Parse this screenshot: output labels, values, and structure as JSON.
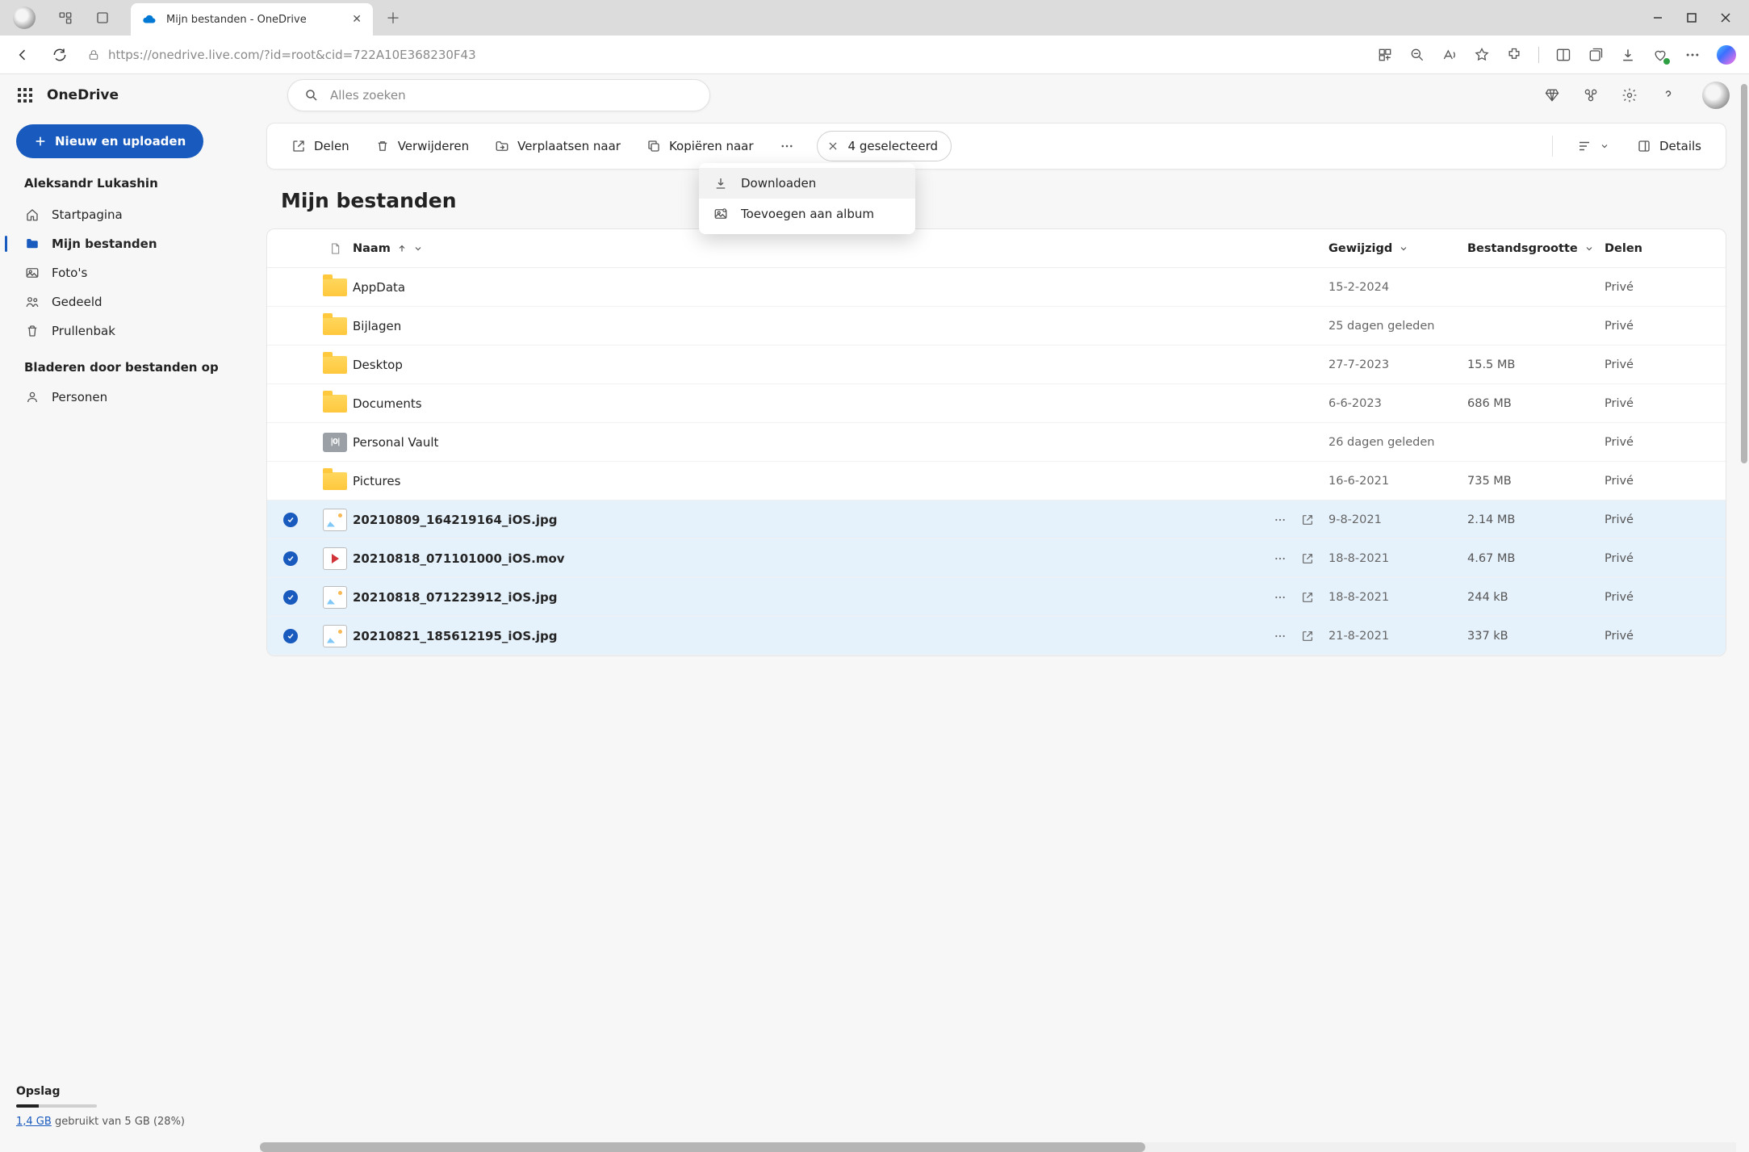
{
  "browser": {
    "tab_title": "Mijn bestanden - OneDrive",
    "url": "https://onedrive.live.com/?id=root&cid=722A10E368230F43"
  },
  "app": {
    "name": "OneDrive",
    "upload_button": "Nieuw en uploaden",
    "search_placeholder": "Alles zoeken"
  },
  "sidebar": {
    "user": "Aleksandr Lukashin",
    "items": [
      {
        "label": "Startpagina"
      },
      {
        "label": "Mijn bestanden"
      },
      {
        "label": "Foto's"
      },
      {
        "label": "Gedeeld"
      },
      {
        "label": "Prullenbak"
      }
    ],
    "browse_label": "Bladeren door bestanden op",
    "browse_items": [
      {
        "label": "Personen"
      }
    ],
    "storage": {
      "title": "Opslag",
      "used_link": "1,4 GB",
      "rest": " gebruikt van 5 GB (28%)"
    }
  },
  "toolbar": {
    "share": "Delen",
    "delete": "Verwijderen",
    "move": "Verplaatsen naar",
    "copy": "Kopiëren naar",
    "selected": "4 geselecteerd",
    "details": "Details"
  },
  "dropdown": {
    "download": "Downloaden",
    "add_album": "Toevoegen aan album"
  },
  "page_title": "Mijn bestanden",
  "columns": {
    "name": "Naam",
    "modified": "Gewijzigd",
    "size": "Bestandsgrootte",
    "share": "Delen"
  },
  "rows": [
    {
      "type": "folder",
      "selected": false,
      "name": "AppData",
      "modified": "15-2-2024",
      "size": "",
      "share": "Privé"
    },
    {
      "type": "folder",
      "selected": false,
      "name": "Bijlagen",
      "modified": "25 dagen geleden",
      "size": "",
      "share": "Privé"
    },
    {
      "type": "folder",
      "selected": false,
      "name": "Desktop",
      "modified": "27-7-2023",
      "size": "15.5 MB",
      "share": "Privé"
    },
    {
      "type": "folder",
      "selected": false,
      "name": "Documents",
      "modified": "6-6-2023",
      "size": "686 MB",
      "share": "Privé"
    },
    {
      "type": "vault",
      "selected": false,
      "name": "Personal Vault",
      "modified": "26 dagen geleden",
      "size": "",
      "share": "Privé"
    },
    {
      "type": "folder",
      "selected": false,
      "name": "Pictures",
      "modified": "16-6-2021",
      "size": "735 MB",
      "share": "Privé"
    },
    {
      "type": "image",
      "selected": true,
      "name": "20210809_164219164_iOS.jpg",
      "modified": "9-8-2021",
      "size": "2.14 MB",
      "share": "Privé"
    },
    {
      "type": "video",
      "selected": true,
      "name": "20210818_071101000_iOS.mov",
      "modified": "18-8-2021",
      "size": "4.67 MB",
      "share": "Privé"
    },
    {
      "type": "image",
      "selected": true,
      "name": "20210818_071223912_iOS.jpg",
      "modified": "18-8-2021",
      "size": "244 kB",
      "share": "Privé"
    },
    {
      "type": "image",
      "selected": true,
      "name": "20210821_185612195_iOS.jpg",
      "modified": "21-8-2021",
      "size": "337 kB",
      "share": "Privé"
    }
  ]
}
